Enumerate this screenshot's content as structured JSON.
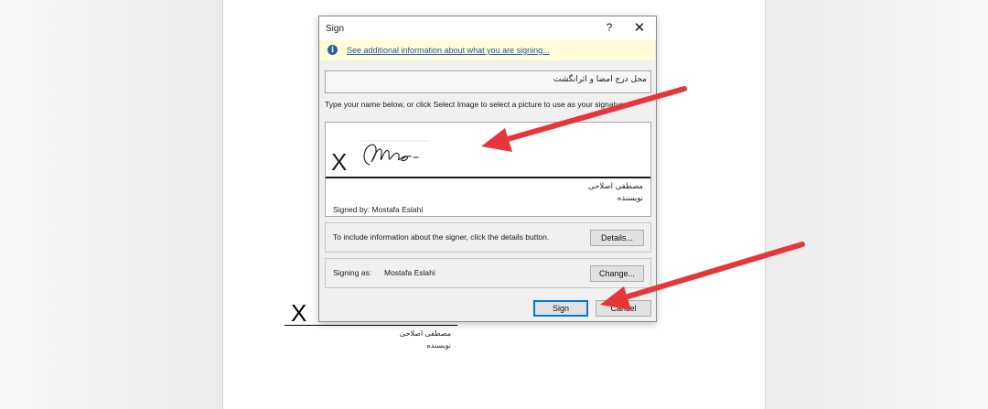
{
  "document": {
    "signature_x": "X",
    "signer_name": "مصطفی اصلاحی",
    "signer_title": "نویسنده"
  },
  "dialog": {
    "title": "Sign",
    "help_label": "?",
    "close_label": "✕",
    "info_link": "See additional information about what you are signing...",
    "purpose_text": "محل درج امضا و اثرانگشت",
    "instruction": "Type your name below, or click Select Image to select a picture to use as your signature:",
    "signature_x": "X",
    "signer_name": "مصطفی اصلاحی",
    "signer_title": "نویسنده",
    "signed_by": "Signed by: Mostafa Eslahi",
    "details_text": "To include information about the signer, click the details button.",
    "details_button": "Details...",
    "signing_as_label": "Signing as:",
    "signing_as_value": "Mostafa Eslahi",
    "change_button": "Change...",
    "sign_button": "Sign",
    "cancel_button": "Cancel"
  },
  "colors": {
    "info_bar": "#fffcd6",
    "link": "#1e56b7",
    "annotation_arrow": "#e8353a",
    "default_button_border": "#0078d7"
  }
}
